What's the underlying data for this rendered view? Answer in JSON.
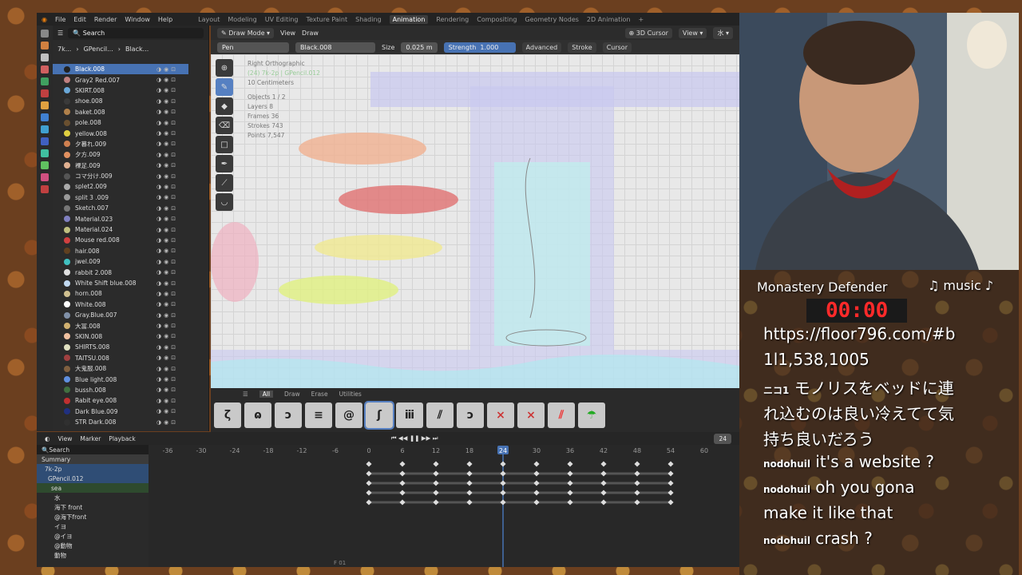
{
  "topbar": {
    "menus": [
      "File",
      "Edit",
      "Render",
      "Window",
      "Help"
    ],
    "workspaces": [
      "Layout",
      "Modeling",
      "UV Editing",
      "Texture Paint",
      "Shading",
      "Animation",
      "Rendering",
      "Compositing",
      "Geometry Nodes",
      "2D Animation"
    ],
    "active": "Animation",
    "plus": "+"
  },
  "outliner": {
    "search_placeholder": "Search",
    "crumb": [
      "7k...",
      "GPencil...",
      "Black..."
    ],
    "materials": [
      {
        "name": "Black.008",
        "color": "#222222"
      },
      {
        "name": "Gray2 Red.007",
        "color": "#c08080"
      },
      {
        "name": "SKIRT.008",
        "color": "#6aa8d8"
      },
      {
        "name": "shoe.008",
        "color": "#3a3a3a"
      },
      {
        "name": "baket.008",
        "color": "#b0804a"
      },
      {
        "name": "pole.008",
        "color": "#6a5030"
      },
      {
        "name": "yellow.008",
        "color": "#e0d040"
      },
      {
        "name": "夕暮れ.009",
        "color": "#d08050"
      },
      {
        "name": "夕方.009",
        "color": "#e09060"
      },
      {
        "name": "裸足.009",
        "color": "#e0b090"
      },
      {
        "name": "コマ分け.009",
        "color": "#555555"
      },
      {
        "name": "splet2.009",
        "color": "#aaaaaa"
      },
      {
        "name": "split 3 .009",
        "color": "#999999"
      },
      {
        "name": "Sketch.007",
        "color": "#777777"
      },
      {
        "name": "Material.023",
        "color": "#8080c0"
      },
      {
        "name": "Material.024",
        "color": "#c0c080"
      },
      {
        "name": "Mouse red.008",
        "color": "#d04040"
      },
      {
        "name": "hair.008",
        "color": "#604020"
      },
      {
        "name": "jwel.009",
        "color": "#40c0c0"
      },
      {
        "name": "rabbit 2.008",
        "color": "#e0e0e0"
      },
      {
        "name": "White Shift blue.008",
        "color": "#c0d8f0"
      },
      {
        "name": "horn.008",
        "color": "#d0c090"
      },
      {
        "name": "White.008",
        "color": "#ffffff"
      },
      {
        "name": "Gray.Blue.007",
        "color": "#8090a8"
      },
      {
        "name": "大冨.008",
        "color": "#d0b070"
      },
      {
        "name": "SKIN.008",
        "color": "#f0c0a0"
      },
      {
        "name": "SHIRTS.008",
        "color": "#e0e0c0"
      },
      {
        "name": "TAITSU.008",
        "color": "#a04040"
      },
      {
        "name": "大鬼服.008",
        "color": "#806040"
      },
      {
        "name": "Blue light.008",
        "color": "#6090e0"
      },
      {
        "name": "bussh.008",
        "color": "#407040"
      },
      {
        "name": "Rabit eye.008",
        "color": "#c03030"
      },
      {
        "name": "Dark Blue.009",
        "color": "#203080"
      },
      {
        "name": "STR Dark.008",
        "color": "#303030"
      }
    ]
  },
  "viewport": {
    "mode": "Draw Mode",
    "view": "View",
    "draw": "Draw",
    "cursor": "3D Cursor",
    "view2": "View",
    "kanji": "水",
    "brush": "Pen",
    "material": "Black.008",
    "size_label": "Size",
    "size_value": "0.025 m",
    "strength_label": "Strength",
    "strength_value": "1.000",
    "advanced": "Advanced",
    "stroke": "Stroke",
    "cursor2": "Cursor",
    "info": {
      "view_name": "Right Orthographic",
      "collection": "(24) 7k-2p | GPencil.012",
      "scale": "10 Centimeters",
      "objects": "Objects    1 / 2",
      "layers": "Layers     8",
      "frames": "Frames   36",
      "strokes": "Strokes  743",
      "points": "Points   7,547"
    }
  },
  "brushbar": {
    "tabs": [
      "All",
      "Draw",
      "Erase",
      "Utilities"
    ],
    "active": "All"
  },
  "dopesheet": {
    "view": "View",
    "marker": "Marker",
    "playback": "Playback",
    "frame": "24",
    "search_placeholder": "Search",
    "ticks": [
      "-36",
      "-30",
      "-24",
      "-18",
      "-12",
      "-6",
      "0",
      "6",
      "12",
      "18",
      "24",
      "30",
      "36",
      "42",
      "48",
      "54",
      "60"
    ],
    "channels": [
      "Summary",
      "7k-2p",
      "GPencil.012",
      "sea",
      "水",
      "海下  front",
      "@海下front",
      "イヨ",
      "@イヨ",
      "@動物",
      "動物"
    ],
    "footer": "F 01"
  },
  "stream": {
    "title": "Monastery Defender",
    "music": "♫ music ♪",
    "timer": "00:00",
    "lines": [
      "https://floor796.com/#b",
      "1l1,538,1005"
    ],
    "chat": [
      {
        "user": "ニコ1",
        "text": "モノリスをベッドに連"
      },
      {
        "user": "",
        "text": "れ込むのは良い冷えてて気"
      },
      {
        "user": "",
        "text": "持ち良いだろう"
      },
      {
        "user": "nodohuil",
        "text": "it's a website ?"
      },
      {
        "user": "nodohuil",
        "text": "oh you gona"
      },
      {
        "user": "",
        "text": "make it like that"
      },
      {
        "user": "nodohuil",
        "text": "crash ?"
      }
    ]
  },
  "colors": {
    "accent": "#4772b3",
    "timer": "#ff2a2a"
  }
}
